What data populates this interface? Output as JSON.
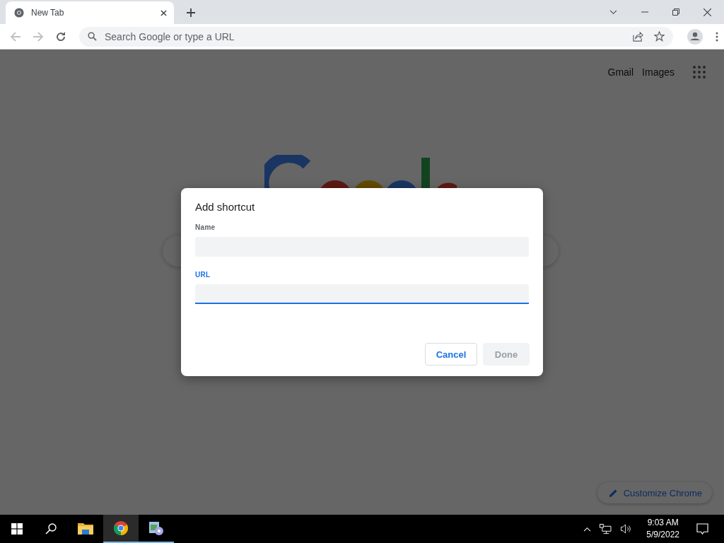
{
  "browser": {
    "tabs": [
      {
        "title": "New Tab",
        "selected": true
      }
    ],
    "address_bar": {
      "placeholder": "Search Google or type a URL"
    }
  },
  "page": {
    "links": [
      "Gmail",
      "Images"
    ],
    "customize_button": "Customize Chrome"
  },
  "dialog": {
    "title": "Add shortcut",
    "fields": [
      {
        "label": "Name",
        "focused": false
      },
      {
        "label": "URL",
        "focused": true
      }
    ],
    "buttons": [
      {
        "label": "Cancel",
        "disabled": false
      },
      {
        "label": "Done",
        "disabled": true
      }
    ]
  },
  "taskbar": {
    "apps": [
      {
        "kind": "explorer",
        "active": false,
        "running": false
      },
      {
        "kind": "chrome",
        "active": true,
        "running": true
      },
      {
        "kind": "app",
        "active": false,
        "running": true
      }
    ],
    "time": "9:03 AM",
    "date": "5/9/2022"
  }
}
